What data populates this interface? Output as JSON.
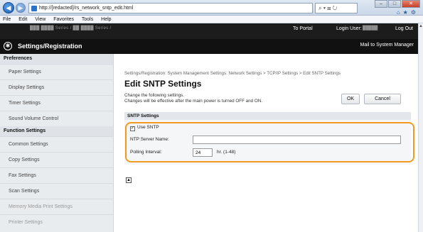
{
  "browser": {
    "url": "http://[redacted]/rs_network_sntp_edit.html",
    "search_label": "⌕ ▾ ⊠ ↻",
    "menu": [
      "File",
      "Edit",
      "View",
      "Favorites",
      "Tools",
      "Help"
    ]
  },
  "header": {
    "device_name": "███ ████  Series / ██ ████  Series /",
    "to_portal": "To Portal",
    "login_user_label": "Login User:",
    "login_user_value": "█████",
    "logout": "Log Out",
    "title": "Settings/Registration",
    "mail": "Mail to System Manager"
  },
  "sidebar": {
    "preferences_heading": "Preferences",
    "preferences": [
      "Paper Settings",
      "Display Settings",
      "Timer Settings",
      "Sound Volume Control"
    ],
    "function_heading": "Function Settings",
    "functions": [
      "Common Settings",
      "Copy Settings",
      "Fax Settings",
      "Scan Settings",
      "Memory Media Print Settings",
      "Printer Settings"
    ]
  },
  "main": {
    "breadcrumb": "Settings/Registration: System Management Settings: Network Settings > TCP/IP Settings > Edit SNTP Settings",
    "title": "Edit SNTP Settings",
    "desc_line1": "Change the following settings.",
    "desc_line2": "Changes will be effective after the main power is turned OFF and ON.",
    "ok": "OK",
    "cancel": "Cancel",
    "section": "SNTP Settings",
    "use_sntp": "Use SNTP",
    "use_sntp_checked": true,
    "ntp_label": "NTP Server Name:",
    "ntp_value": "",
    "polling_label": "Polling Interval:",
    "polling_value": "24",
    "polling_unit": "hr. (1-48)"
  },
  "colors": {
    "highlight": "#f29a1f",
    "header_bg": "#1c1c1c"
  }
}
